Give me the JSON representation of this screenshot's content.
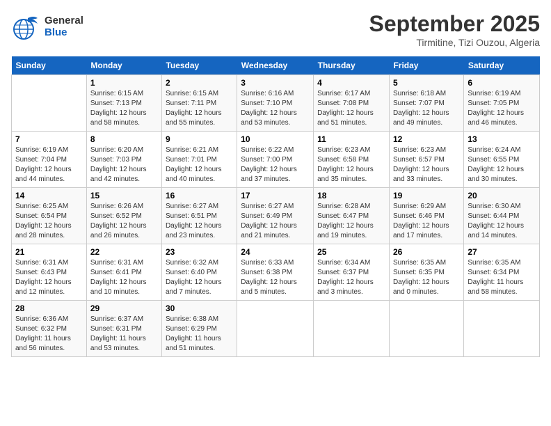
{
  "header": {
    "logo_general": "General",
    "logo_blue": "Blue",
    "month_title": "September 2025",
    "location": "Tirmitine, Tizi Ouzou, Algeria"
  },
  "days_of_week": [
    "Sunday",
    "Monday",
    "Tuesday",
    "Wednesday",
    "Thursday",
    "Friday",
    "Saturday"
  ],
  "weeks": [
    [
      {
        "day": "",
        "sunrise": "",
        "sunset": "",
        "daylight": ""
      },
      {
        "day": "1",
        "sunrise": "6:15 AM",
        "sunset": "7:13 PM",
        "daylight": "12 hours and 58 minutes."
      },
      {
        "day": "2",
        "sunrise": "6:15 AM",
        "sunset": "7:11 PM",
        "daylight": "12 hours and 55 minutes."
      },
      {
        "day": "3",
        "sunrise": "6:16 AM",
        "sunset": "7:10 PM",
        "daylight": "12 hours and 53 minutes."
      },
      {
        "day": "4",
        "sunrise": "6:17 AM",
        "sunset": "7:08 PM",
        "daylight": "12 hours and 51 minutes."
      },
      {
        "day": "5",
        "sunrise": "6:18 AM",
        "sunset": "7:07 PM",
        "daylight": "12 hours and 49 minutes."
      },
      {
        "day": "6",
        "sunrise": "6:19 AM",
        "sunset": "7:05 PM",
        "daylight": "12 hours and 46 minutes."
      }
    ],
    [
      {
        "day": "7",
        "sunrise": "6:19 AM",
        "sunset": "7:04 PM",
        "daylight": "12 hours and 44 minutes."
      },
      {
        "day": "8",
        "sunrise": "6:20 AM",
        "sunset": "7:03 PM",
        "daylight": "12 hours and 42 minutes."
      },
      {
        "day": "9",
        "sunrise": "6:21 AM",
        "sunset": "7:01 PM",
        "daylight": "12 hours and 40 minutes."
      },
      {
        "day": "10",
        "sunrise": "6:22 AM",
        "sunset": "7:00 PM",
        "daylight": "12 hours and 37 minutes."
      },
      {
        "day": "11",
        "sunrise": "6:23 AM",
        "sunset": "6:58 PM",
        "daylight": "12 hours and 35 minutes."
      },
      {
        "day": "12",
        "sunrise": "6:23 AM",
        "sunset": "6:57 PM",
        "daylight": "12 hours and 33 minutes."
      },
      {
        "day": "13",
        "sunrise": "6:24 AM",
        "sunset": "6:55 PM",
        "daylight": "12 hours and 30 minutes."
      }
    ],
    [
      {
        "day": "14",
        "sunrise": "6:25 AM",
        "sunset": "6:54 PM",
        "daylight": "12 hours and 28 minutes."
      },
      {
        "day": "15",
        "sunrise": "6:26 AM",
        "sunset": "6:52 PM",
        "daylight": "12 hours and 26 minutes."
      },
      {
        "day": "16",
        "sunrise": "6:27 AM",
        "sunset": "6:51 PM",
        "daylight": "12 hours and 23 minutes."
      },
      {
        "day": "17",
        "sunrise": "6:27 AM",
        "sunset": "6:49 PM",
        "daylight": "12 hours and 21 minutes."
      },
      {
        "day": "18",
        "sunrise": "6:28 AM",
        "sunset": "6:47 PM",
        "daylight": "12 hours and 19 minutes."
      },
      {
        "day": "19",
        "sunrise": "6:29 AM",
        "sunset": "6:46 PM",
        "daylight": "12 hours and 17 minutes."
      },
      {
        "day": "20",
        "sunrise": "6:30 AM",
        "sunset": "6:44 PM",
        "daylight": "12 hours and 14 minutes."
      }
    ],
    [
      {
        "day": "21",
        "sunrise": "6:31 AM",
        "sunset": "6:43 PM",
        "daylight": "12 hours and 12 minutes."
      },
      {
        "day": "22",
        "sunrise": "6:31 AM",
        "sunset": "6:41 PM",
        "daylight": "12 hours and 10 minutes."
      },
      {
        "day": "23",
        "sunrise": "6:32 AM",
        "sunset": "6:40 PM",
        "daylight": "12 hours and 7 minutes."
      },
      {
        "day": "24",
        "sunrise": "6:33 AM",
        "sunset": "6:38 PM",
        "daylight": "12 hours and 5 minutes."
      },
      {
        "day": "25",
        "sunrise": "6:34 AM",
        "sunset": "6:37 PM",
        "daylight": "12 hours and 3 minutes."
      },
      {
        "day": "26",
        "sunrise": "6:35 AM",
        "sunset": "6:35 PM",
        "daylight": "12 hours and 0 minutes."
      },
      {
        "day": "27",
        "sunrise": "6:35 AM",
        "sunset": "6:34 PM",
        "daylight": "11 hours and 58 minutes."
      }
    ],
    [
      {
        "day": "28",
        "sunrise": "6:36 AM",
        "sunset": "6:32 PM",
        "daylight": "11 hours and 56 minutes."
      },
      {
        "day": "29",
        "sunrise": "6:37 AM",
        "sunset": "6:31 PM",
        "daylight": "11 hours and 53 minutes."
      },
      {
        "day": "30",
        "sunrise": "6:38 AM",
        "sunset": "6:29 PM",
        "daylight": "11 hours and 51 minutes."
      },
      {
        "day": "",
        "sunrise": "",
        "sunset": "",
        "daylight": ""
      },
      {
        "day": "",
        "sunrise": "",
        "sunset": "",
        "daylight": ""
      },
      {
        "day": "",
        "sunrise": "",
        "sunset": "",
        "daylight": ""
      },
      {
        "day": "",
        "sunrise": "",
        "sunset": "",
        "daylight": ""
      }
    ]
  ]
}
